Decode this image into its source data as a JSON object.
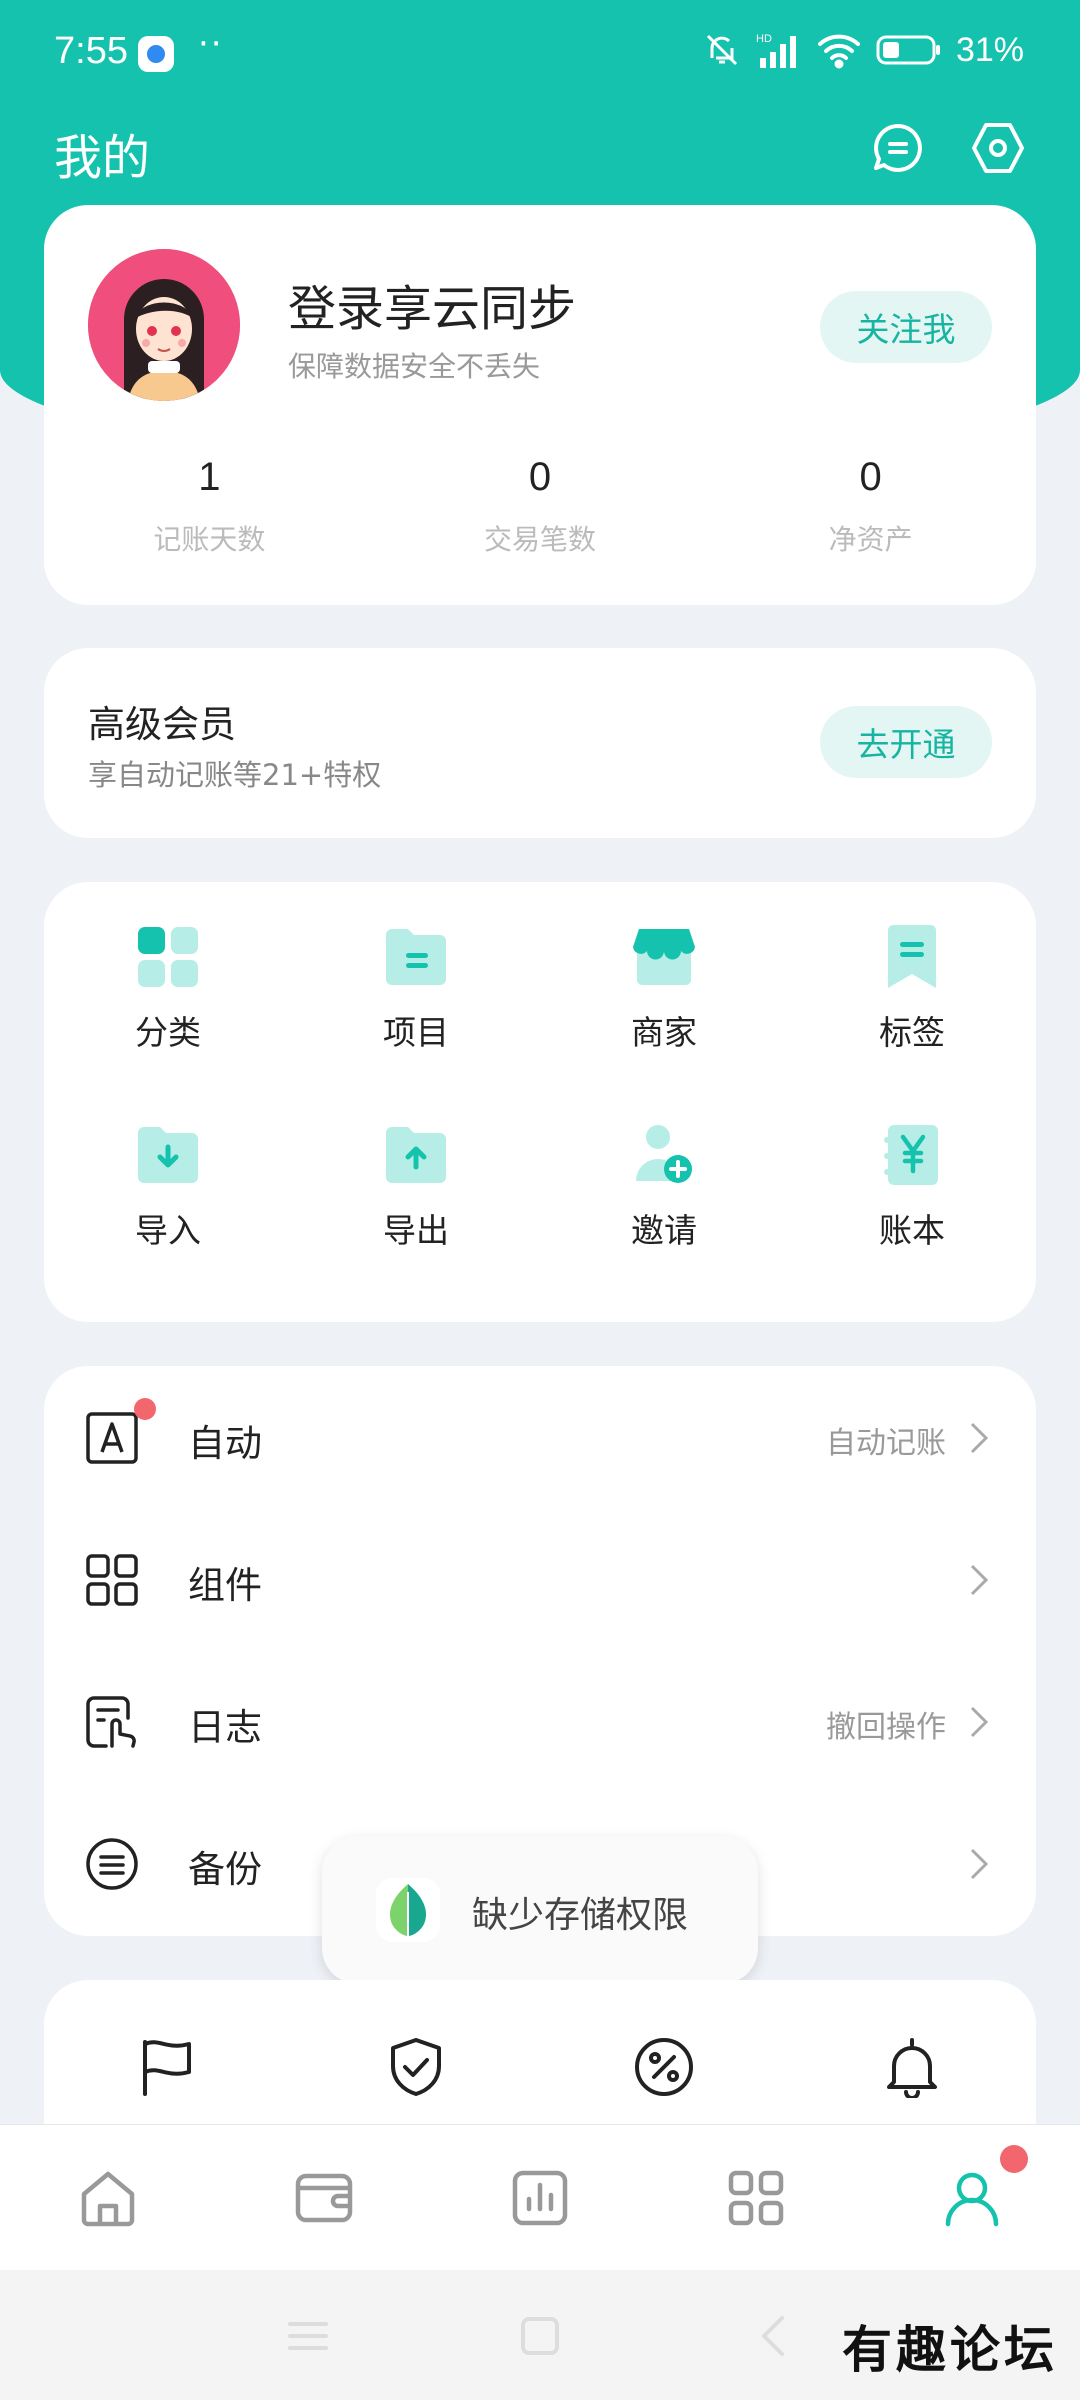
{
  "status_bar": {
    "time": "7:55",
    "more": "··",
    "battery": "31%"
  },
  "header": {
    "title": "我的"
  },
  "profile": {
    "login_title": "登录享云同步",
    "login_subtitle": "保障数据安全不丢失",
    "follow_label": "关注我",
    "stats": [
      {
        "value": "1",
        "label": "记账天数"
      },
      {
        "value": "0",
        "label": "交易笔数"
      },
      {
        "value": "0",
        "label": "净资产"
      }
    ]
  },
  "vip": {
    "title": "高级会员",
    "subtitle": "享自动记账等21+特权",
    "button": "去开通"
  },
  "grid": {
    "items": [
      {
        "label": "分类",
        "icon": "category-icon"
      },
      {
        "label": "项目",
        "icon": "project-folder-icon"
      },
      {
        "label": "商家",
        "icon": "store-icon"
      },
      {
        "label": "标签",
        "icon": "bookmark-tag-icon"
      },
      {
        "label": "导入",
        "icon": "import-folder-icon"
      },
      {
        "label": "导出",
        "icon": "export-folder-icon"
      },
      {
        "label": "邀请",
        "icon": "invite-user-icon"
      },
      {
        "label": "账本",
        "icon": "ledger-yen-icon"
      }
    ]
  },
  "menu": {
    "items": [
      {
        "label": "自动",
        "value": "自动记账",
        "icon": "auto-a-icon"
      },
      {
        "label": "组件",
        "value": "",
        "icon": "widgets-grid-icon"
      },
      {
        "label": "日志",
        "value": "撤回操作",
        "icon": "log-touch-icon"
      },
      {
        "label": "备份",
        "value": "",
        "icon": "backup-list-icon"
      }
    ]
  },
  "toast": {
    "text": "缺少存储权限",
    "icon": "leaf-app-icon"
  },
  "bottom_icons": [
    "flag-icon",
    "shield-check-icon",
    "percent-icon",
    "bell-icon"
  ],
  "tabs": [
    "home-icon",
    "wallet-icon",
    "stats-chart-icon",
    "apps-grid-icon",
    "profile-user-icon"
  ],
  "colors": {
    "accent": "#15c2ad",
    "accent_light": "#b6ede6",
    "badge_red": "#f2676d"
  },
  "watermark": "有趣论坛"
}
